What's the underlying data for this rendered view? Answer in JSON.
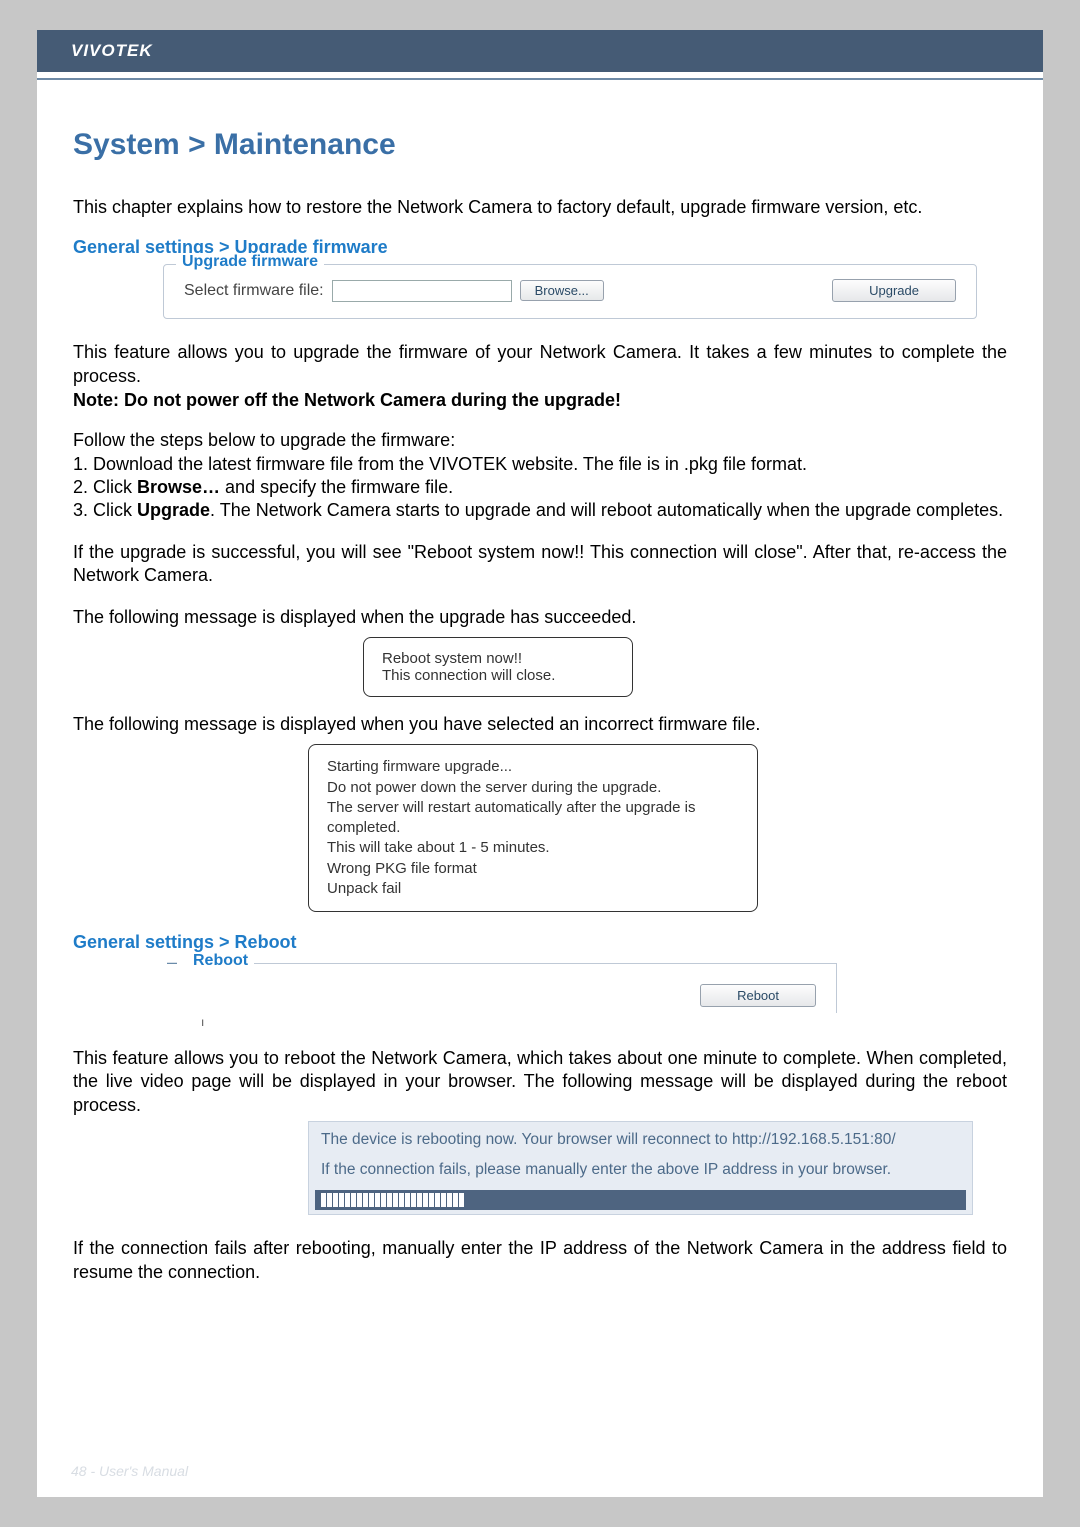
{
  "header": {
    "brand": "VIVOTEK"
  },
  "title": "System > Maintenance",
  "intro": "This chapter explains how to restore the Network Camera to factory default, upgrade firmware version, etc.",
  "section_upgrade": {
    "title": "General settings > Upgrade firmware",
    "legend": "Upgrade firmware",
    "label": "Select firmware file:",
    "browse": "Browse...",
    "upgrade": "Upgrade",
    "desc": "This feature allows you to upgrade the firmware of your Network Camera. It takes a few minutes to complete the process.",
    "note": "Note: Do not power off the Network Camera during the upgrade!",
    "steps_intro": "Follow the steps below to upgrade the firmware:",
    "step1": "1. Download the latest firmware file from the VIVOTEK website. The file is in .pkg file format.",
    "step2a": "2. Click ",
    "step2b": "Browse…",
    "step2c": " and specify the firmware file.",
    "step3a": "3. Click ",
    "step3b": "Upgrade",
    "step3c": ". The Network Camera starts to upgrade and will reboot automatically when the upgrade completes.",
    "success_intro": "If the upgrade is successful, you will see \"Reboot system now!! This connection will close\". After that, re-access the Network Camera.",
    "msg_success_intro": "The following message is displayed when the upgrade has succeeded.",
    "msg_success_l1": "Reboot system now!!",
    "msg_success_l2": "This connection will close.",
    "msg_fail_intro": "The following message is displayed when you have selected an incorrect firmware file.",
    "msg_fail_l1": "Starting firmware upgrade...",
    "msg_fail_l2": "Do not power down the server during the upgrade.",
    "msg_fail_l3": "The server will restart automatically after the upgrade is completed.",
    "msg_fail_l4": "This will take about 1 - 5 minutes.",
    "msg_fail_l5": "Wrong PKG file format",
    "msg_fail_l6": "Unpack fail"
  },
  "section_reboot": {
    "title": "General settings > Reboot",
    "legend": "Reboot",
    "button": "Reboot",
    "desc": "This feature allows you to reboot the Network Camera, which takes about one minute to complete. When completed, the live video page will be displayed in your browser. The following message will be displayed during the reboot process.",
    "msg_l1": "The device is rebooting now. Your browser will reconnect to http://192.168.5.151:80/",
    "msg_l2": "If the connection fails, please manually enter the above IP address in your browser.",
    "progress_blocks": 24,
    "closing": "If the connection fails after rebooting, manually enter the IP address of the Network Camera in the address field to resume the connection."
  },
  "footer": "48 - User's Manual"
}
